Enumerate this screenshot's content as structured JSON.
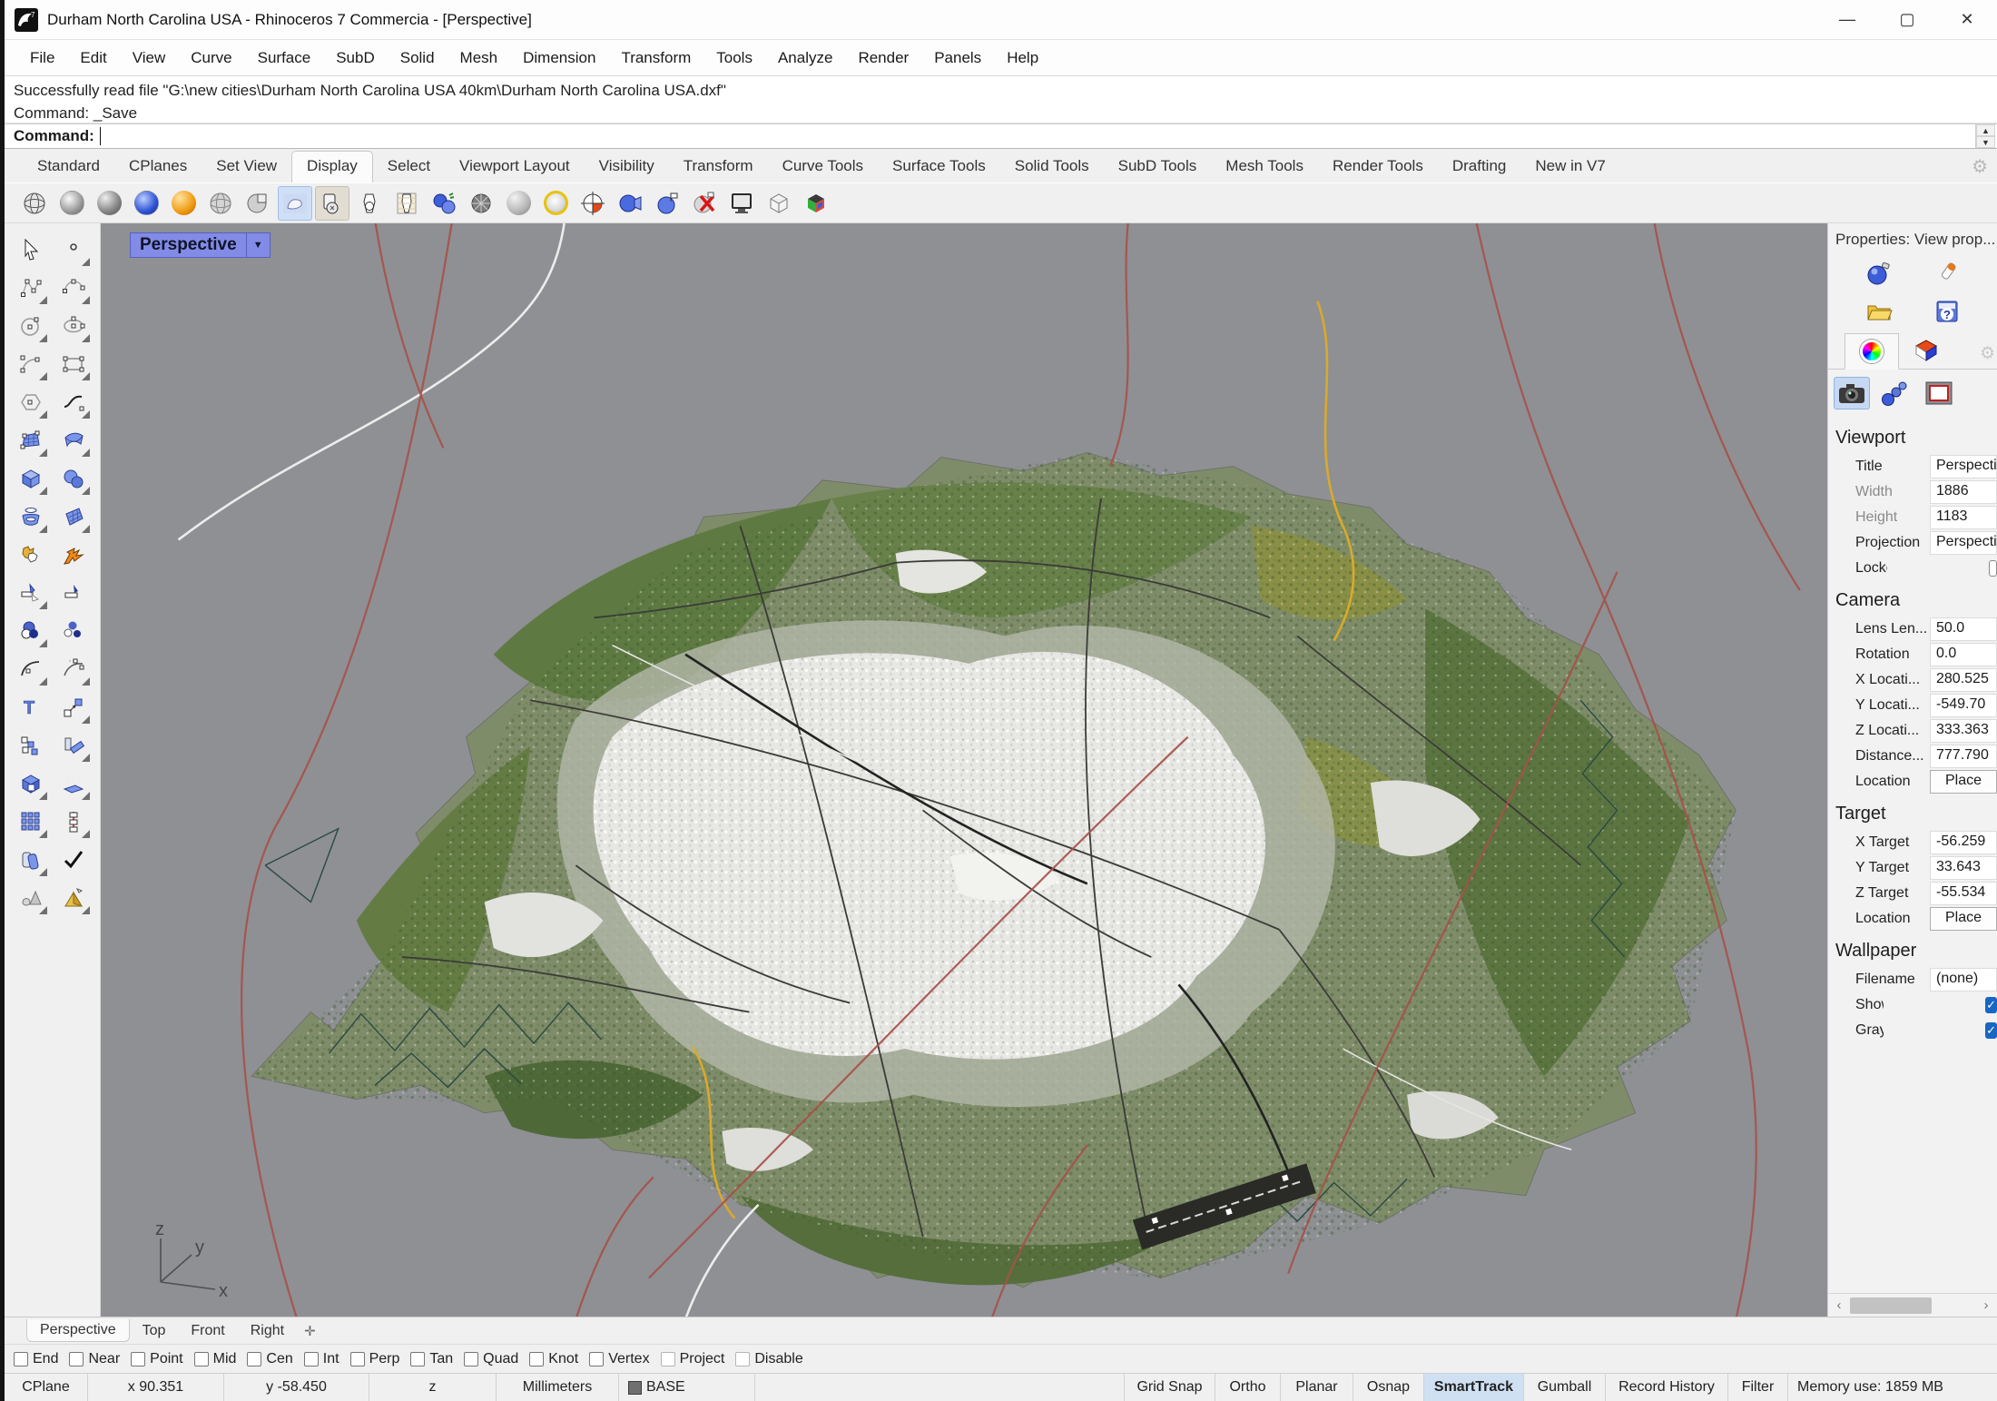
{
  "window": {
    "title": "Durham North Carolina USA - Rhinoceros 7 Commercia - [Perspective]"
  },
  "menu": {
    "items": [
      "File",
      "Edit",
      "View",
      "Curve",
      "Surface",
      "SubD",
      "Solid",
      "Mesh",
      "Dimension",
      "Transform",
      "Tools",
      "Analyze",
      "Render",
      "Panels",
      "Help"
    ]
  },
  "command": {
    "history": [
      "Successfully read file \"G:\\new cities\\Durham North Carolina USA 40km\\Durham North Carolina USA.dxf\"",
      "Command: _Save"
    ],
    "prompt": "Command:"
  },
  "toolbar_tabs": {
    "items": [
      "Standard",
      "CPlanes",
      "Set View",
      "Display",
      "Select",
      "Viewport Layout",
      "Visibility",
      "Transform",
      "Curve Tools",
      "Surface Tools",
      "Solid Tools",
      "SubD Tools",
      "Mesh Tools",
      "Render Tools",
      "Drafting",
      "New in V7"
    ],
    "active": "Display"
  },
  "viewport": {
    "label": "Perspective",
    "axis": {
      "x": "x",
      "y": "y",
      "z": "z"
    },
    "tabs": [
      "Perspective",
      "Top",
      "Front",
      "Right"
    ],
    "active_tab": "Perspective"
  },
  "props": {
    "title": "Properties: View prop...",
    "viewport_header": "Viewport",
    "viewport_rows": [
      {
        "label": "Title",
        "value": "Perspective"
      },
      {
        "label": "Width",
        "value": "1886"
      },
      {
        "label": "Height",
        "value": "1183"
      },
      {
        "label": "Projection",
        "value": "Perspective"
      },
      {
        "label": "Locked",
        "value": ""
      }
    ],
    "camera_header": "Camera",
    "camera_rows": [
      {
        "label": "Lens Len...",
        "value": "50.0"
      },
      {
        "label": "Rotation",
        "value": "0.0"
      },
      {
        "label": "X Locati...",
        "value": "280.525"
      },
      {
        "label": "Y Locati...",
        "value": "-549.70"
      },
      {
        "label": "Z Locati...",
        "value": "333.363"
      },
      {
        "label": "Distance...",
        "value": "777.790"
      },
      {
        "label": "Location",
        "value": "Place"
      }
    ],
    "target_header": "Target",
    "target_rows": [
      {
        "label": "X Target",
        "value": "-56.259"
      },
      {
        "label": "Y Target",
        "value": "33.643"
      },
      {
        "label": "Z Target",
        "value": "-55.534"
      },
      {
        "label": "Location",
        "value": "Place"
      }
    ],
    "wallpaper_header": "Wallpaper",
    "wallpaper_rows": [
      {
        "label": "Filename",
        "value": "(none)"
      },
      {
        "label": "Show",
        "value": ""
      },
      {
        "label": "Gray",
        "value": ""
      }
    ]
  },
  "osnap": {
    "items": [
      "End",
      "Near",
      "Point",
      "Mid",
      "Cen",
      "Int",
      "Perp",
      "Tan",
      "Quad",
      "Knot",
      "Vertex",
      "Project",
      "Disable"
    ]
  },
  "status": {
    "cplane": "CPlane",
    "x": "x 90.351",
    "y": "y -58.450",
    "z": "z",
    "units": "Millimeters",
    "layer": "BASE",
    "grid_snap": "Grid Snap",
    "ortho": "Ortho",
    "planar": "Planar",
    "osnap": "Osnap",
    "smarttrack": "SmartTrack",
    "gumball": "Gumball",
    "record_history": "Record History",
    "filter": "Filter",
    "memory": "Memory use: 1859 MB"
  },
  "colors": {
    "viewport_bg": "#8E9094",
    "selection_blue": "#828CE6",
    "checkbox_blue": "#1766c2",
    "smarttrack_bg": "#cfe0f2"
  }
}
